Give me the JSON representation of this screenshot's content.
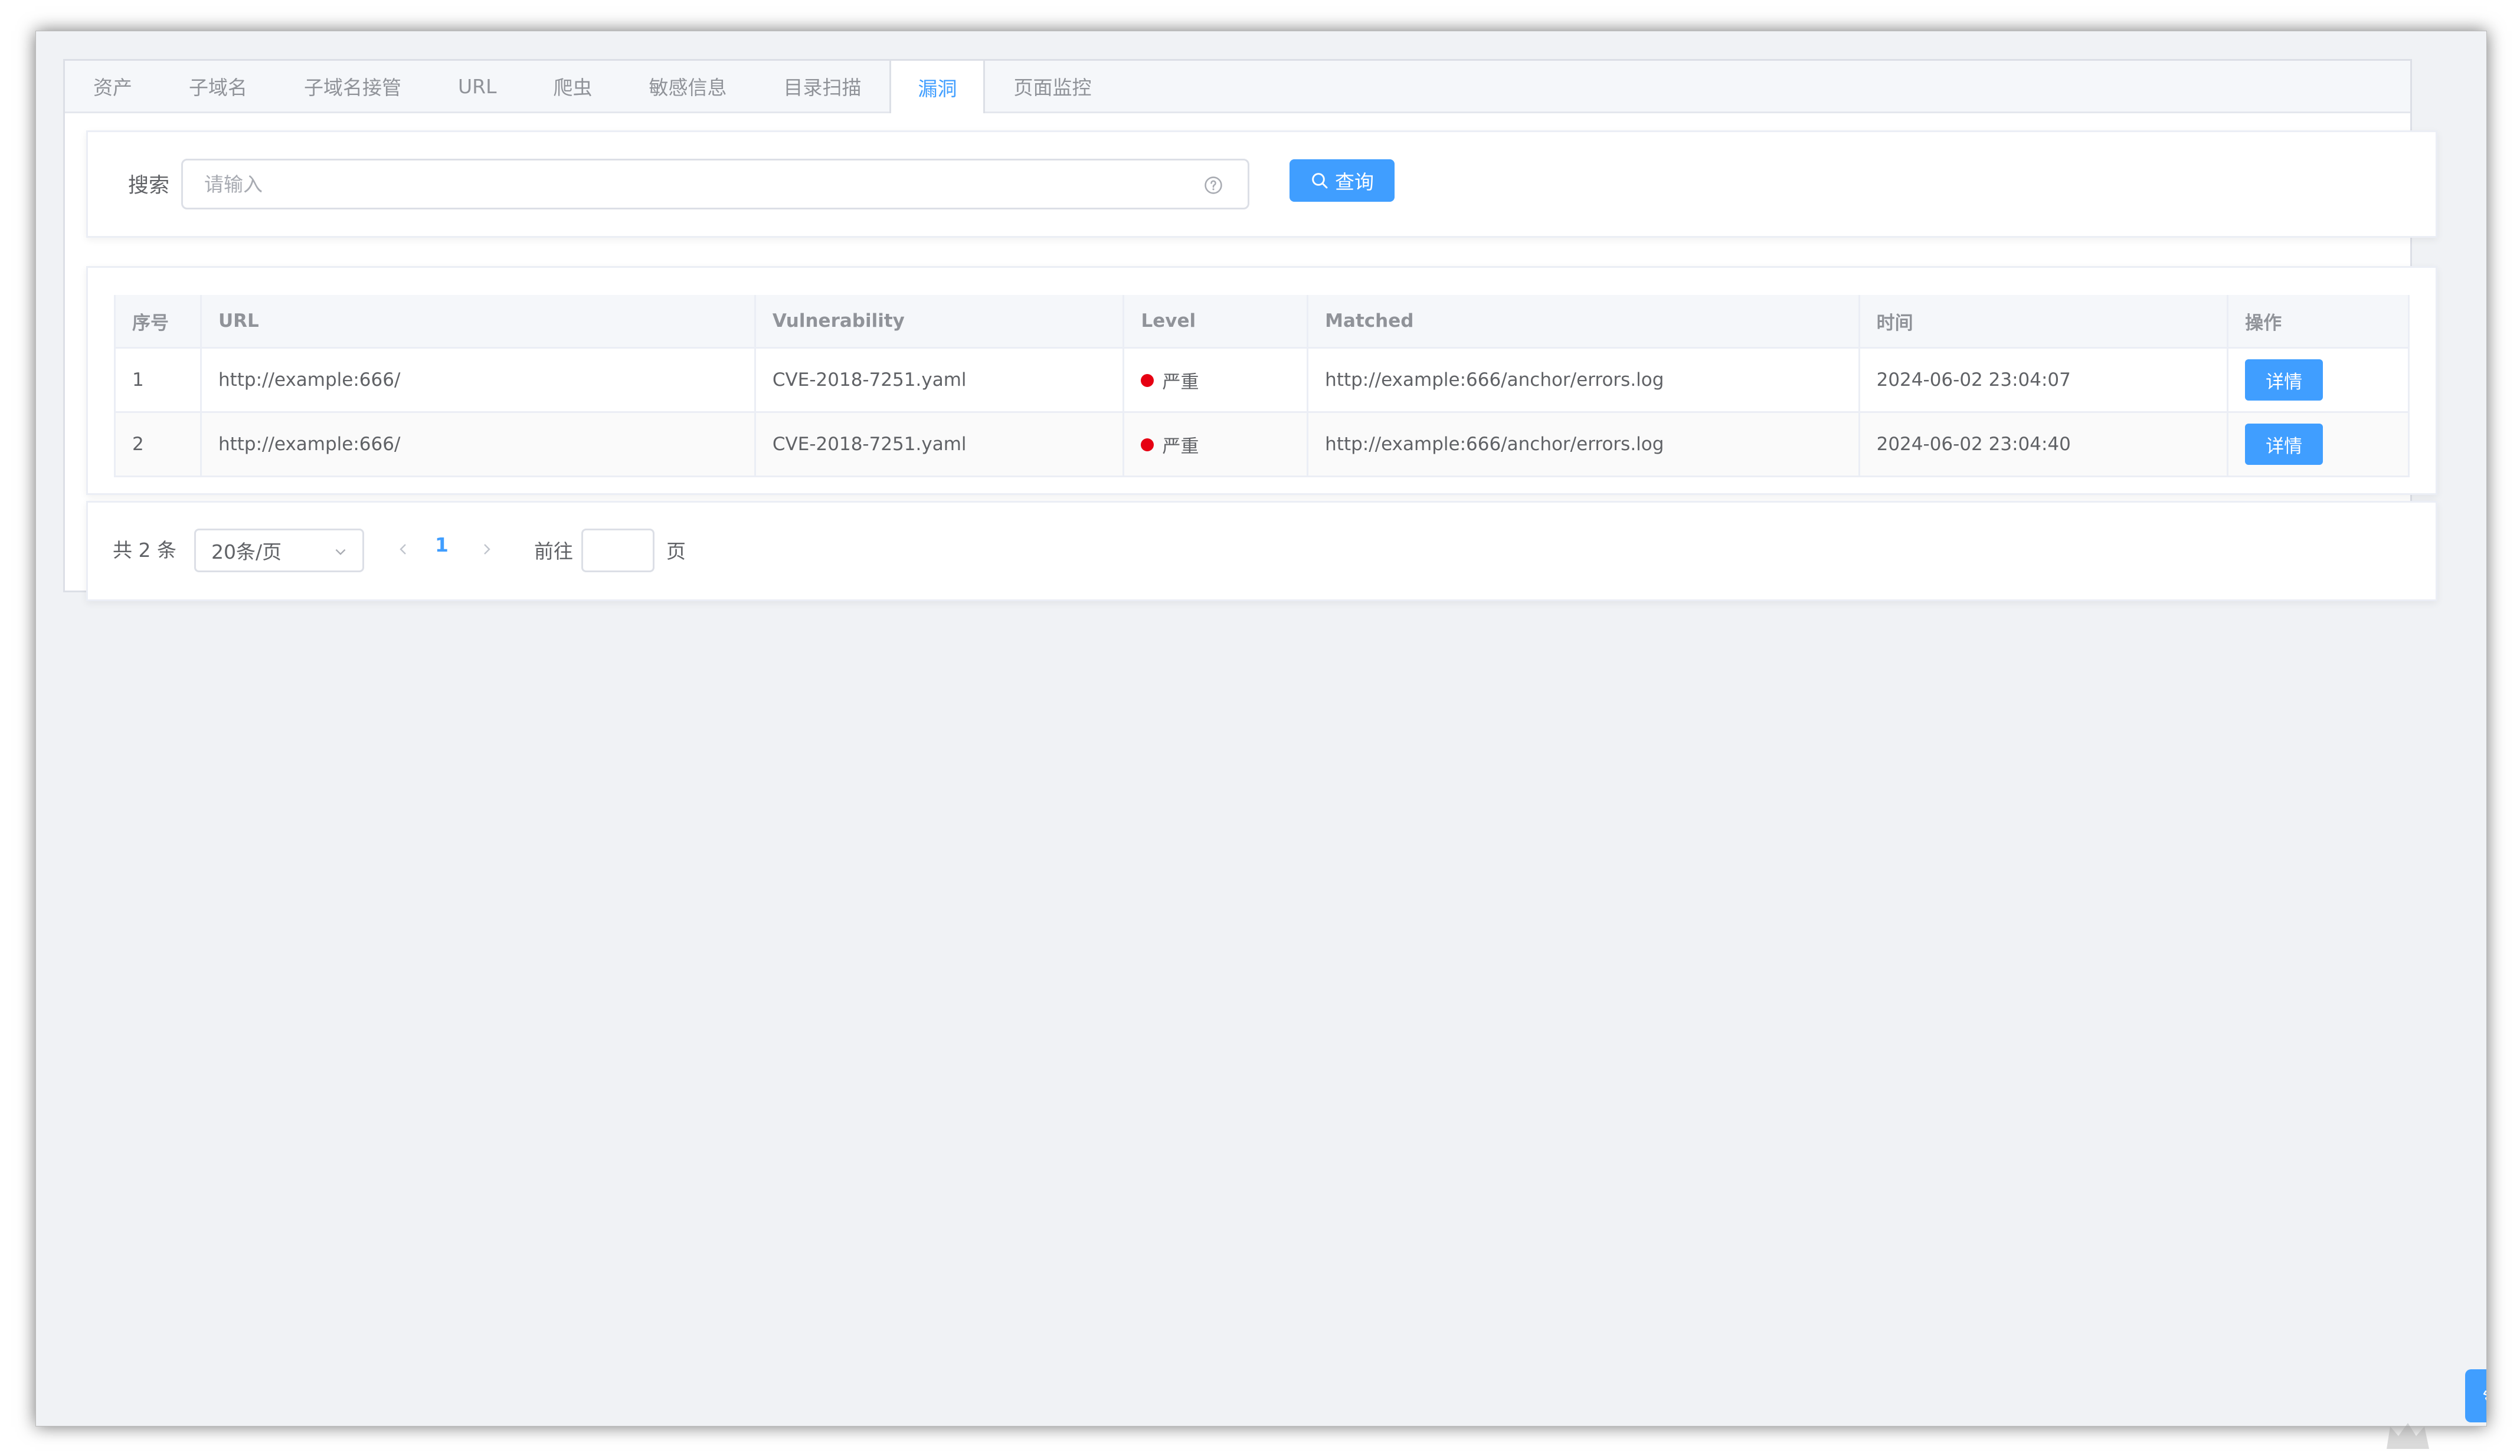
{
  "tabs": [
    {
      "label": "资产"
    },
    {
      "label": "子域名"
    },
    {
      "label": "子域名接管"
    },
    {
      "label": "URL"
    },
    {
      "label": "爬虫"
    },
    {
      "label": "敏感信息"
    },
    {
      "label": "目录扫描"
    },
    {
      "label": "漏洞",
      "active": true
    },
    {
      "label": "页面监控"
    }
  ],
  "search": {
    "label": "搜索",
    "placeholder": "请输入",
    "value": "",
    "button_label": "查询"
  },
  "table": {
    "columns": [
      "序号",
      "URL",
      "Vulnerability",
      "Level",
      "Matched",
      "时间",
      "操作"
    ],
    "rows": [
      {
        "index": "1",
        "url": "http://example:666/",
        "vulnerability": "CVE-2018-7251.yaml",
        "level": "严重",
        "matched": "http://example:666/anchor/errors.log",
        "time": "2024-06-02 23:04:07",
        "action": "详情"
      },
      {
        "index": "2",
        "url": "http://example:666/",
        "vulnerability": "CVE-2018-7251.yaml",
        "level": "严重",
        "matched": "http://example:666/anchor/errors.log",
        "time": "2024-06-02 23:04:40",
        "action": "详情"
      }
    ]
  },
  "pagination": {
    "total": "共 2 条",
    "page_size": "20条/页",
    "current_page": "1",
    "goto_label": "前往",
    "page_suffix": "页",
    "jump_value": ""
  },
  "colors": {
    "accent": "#409eff",
    "level_critical": "#e60012",
    "background": "#f0f2f5"
  },
  "icons": {
    "search_button": "search-icon",
    "input_suffix": "help-icon",
    "page_size": "chevron-down-icon",
    "prev": "chevron-left-icon",
    "next": "chevron-right-icon",
    "floating": "gear-icon"
  }
}
